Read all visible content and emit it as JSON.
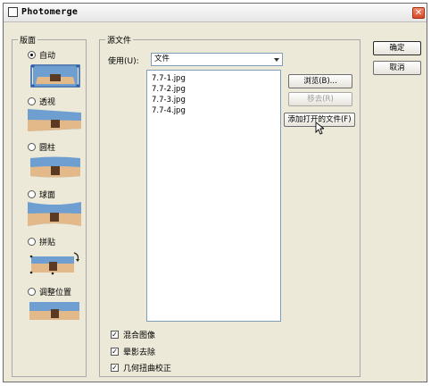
{
  "window": {
    "title": "Photomerge",
    "close_glyph": "✕"
  },
  "layout_group": {
    "legend": "版面",
    "options": [
      {
        "label": "自动",
        "checked": true
      },
      {
        "label": "透视",
        "checked": false
      },
      {
        "label": "圆柱",
        "checked": false
      },
      {
        "label": "球面",
        "checked": false
      },
      {
        "label": "拼贴",
        "checked": false
      },
      {
        "label": "调整位置",
        "checked": false
      }
    ]
  },
  "source_group": {
    "legend": "源文件",
    "use_label": "使用(U):",
    "use_value": "文件",
    "files": [
      "7.7-1.jpg",
      "7.7-2.jpg",
      "7.7-3.jpg",
      "7.7-4.jpg"
    ],
    "browse_label": "浏览(B)...",
    "remove_label": "移去(R)",
    "add_open_label": "添加打开的文件(F)"
  },
  "checkboxes": [
    {
      "label": "混合图像",
      "checked": true
    },
    {
      "label": "晕影去除",
      "checked": true
    },
    {
      "label": "几何扭曲校正",
      "checked": true
    }
  ],
  "buttons": {
    "ok": "确定",
    "cancel": "取消"
  },
  "colors": {
    "dialog_bg": "#ece9d8",
    "sky": "#6f9fd0",
    "building": "#e3b98a",
    "close_button": "#d64a2a"
  }
}
